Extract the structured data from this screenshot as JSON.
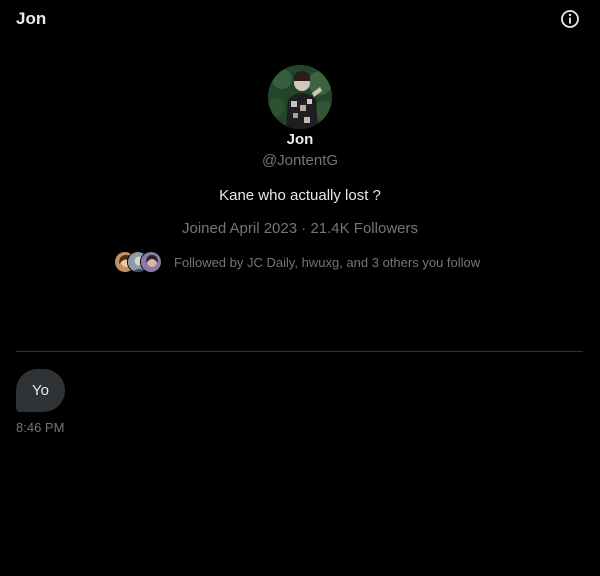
{
  "header": {
    "title": "Jon",
    "info_icon": "info-circle-icon"
  },
  "profile": {
    "name": "Jon",
    "handle": "@JontentG",
    "bio": "Kane who actually lost ?",
    "joined": "Joined April 2023",
    "separator": "·",
    "followers": "21.4K Followers",
    "followed_by": "Followed by JC Daily, hwuxg, and 3 others you follow"
  },
  "messages": [
    {
      "text": "Yo",
      "time": "8:46 PM"
    }
  ],
  "colors": {
    "background": "#000000",
    "text_primary": "#e7e9ea",
    "text_secondary": "#71767b",
    "bubble": "#2f3336",
    "divider": "#2f3336"
  }
}
